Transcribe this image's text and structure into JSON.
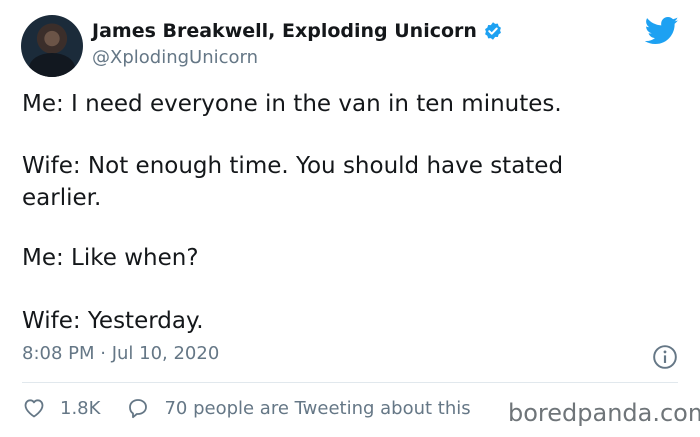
{
  "author": {
    "name": "James Breakwell, Exploding Unicorn",
    "handle": "@XplodingUnicorn"
  },
  "tweet": {
    "line1": "Me: I need everyone in the van in ten minutes.",
    "line2": "Wife: Not enough time. You should have stated",
    "line3": "earlier.",
    "line4": "Me: Like when?",
    "line5": "Wife: Yesterday.",
    "timestamp": "8:08 PM · Jul 10, 2020"
  },
  "actions": {
    "likes": "1.8K",
    "tweeting": "70 people are Tweeting about this"
  },
  "watermark": "boredpanda.com",
  "colors": {
    "twitter_blue": "#1da1f2",
    "secondary_text": "#657786"
  }
}
